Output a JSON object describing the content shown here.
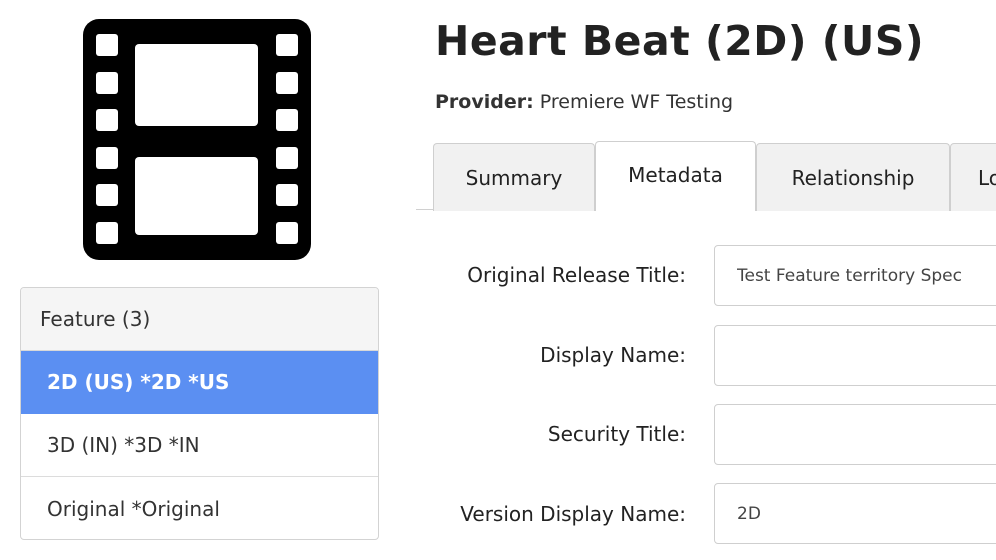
{
  "page": {
    "title": "Heart Beat (2D) (US)",
    "provider_label": "Provider:",
    "provider_value": "Premiere WF Testing"
  },
  "icon": {
    "name": "film-strip-icon"
  },
  "variants": {
    "header": "Feature (3)",
    "items": [
      {
        "label": "2D (US) *2D *US",
        "active": true
      },
      {
        "label": "3D (IN) *3D *IN",
        "active": false
      },
      {
        "label": "Original *Original",
        "active": false
      }
    ]
  },
  "tabs": [
    {
      "label": "Summary",
      "active": false
    },
    {
      "label": "Metadata",
      "active": true
    },
    {
      "label": "Relationship",
      "active": false
    },
    {
      "label": "Lo",
      "active": false
    }
  ],
  "form": {
    "fields": [
      {
        "label": "Original Release Title:",
        "value": "Test Feature territory Spec"
      },
      {
        "label": "Display Name:",
        "value": ""
      },
      {
        "label": "Security Title:",
        "value": ""
      },
      {
        "label": "Version Display Name:",
        "value": "2D"
      }
    ]
  },
  "colors": {
    "accent": "#5b8ff2",
    "icon": "#000000"
  }
}
